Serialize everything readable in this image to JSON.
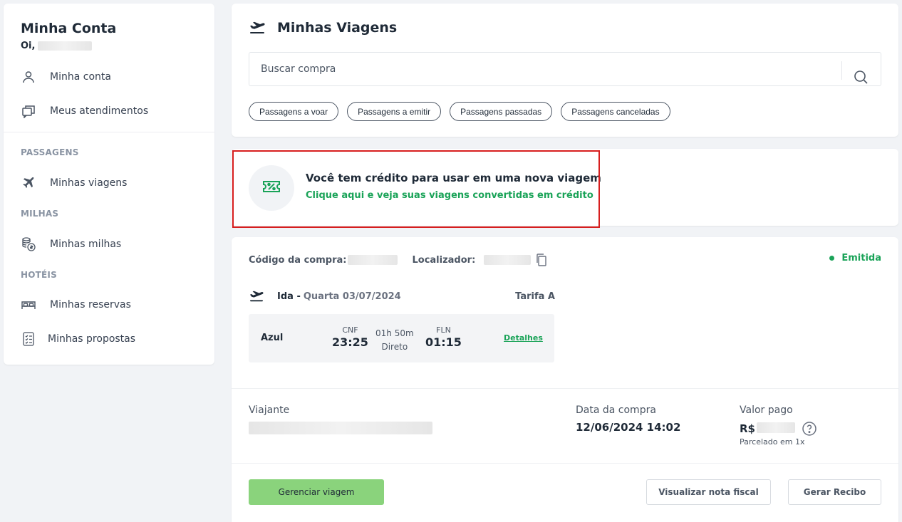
{
  "sidebar": {
    "title": "Minha Conta",
    "greeting": "Oi,",
    "items": [
      {
        "label": "Minha conta",
        "icon": "user-icon"
      },
      {
        "label": "Meus atendimentos",
        "icon": "chat-icon"
      }
    ],
    "sections": [
      {
        "title": "PASSAGENS",
        "items": [
          {
            "label": "Minhas viagens",
            "icon": "airplane-icon"
          }
        ]
      },
      {
        "title": "MILHAS",
        "items": [
          {
            "label": "Minhas milhas",
            "icon": "coins-icon"
          }
        ]
      },
      {
        "title": "HOTÉIS",
        "items": [
          {
            "label": "Minhas reservas",
            "icon": "bed-icon"
          },
          {
            "label": "Minhas propostas",
            "icon": "checklist-icon"
          }
        ]
      }
    ]
  },
  "header": {
    "title": "Minhas Viagens",
    "search_placeholder": "Buscar compra",
    "filters": [
      "Passagens a voar",
      "Passagens a emitir",
      "Passagens passadas",
      "Passagens canceladas"
    ]
  },
  "credit": {
    "title": "Você tem crédito para usar em uma nova viagem",
    "link": "Clique aqui e veja suas viagens convertidas em crédito",
    "highlight_color": "#d71e1e"
  },
  "trip": {
    "purchase_code_label": "Código da compra:",
    "locator_label": "Localizador:",
    "status": "Emitida",
    "leg": {
      "direction": "Ida -",
      "date": "Quarta 03/07/2024",
      "fare": "Tarifa A",
      "airline": "Azul",
      "origin_code": "CNF",
      "departure_time": "23:25",
      "duration": "01h 50m",
      "stops": "Direto",
      "destination_code": "FLN",
      "arrival_time": "01:15",
      "details_link": "Detalhes"
    },
    "traveler_label": "Viajante",
    "purchase_date_label": "Data da compra",
    "purchase_date": "12/06/2024 14:02",
    "paid_label": "Valor pago",
    "currency": "R$",
    "installments": "Parcelado em 1x",
    "buttons": {
      "manage": "Gerenciar viagem",
      "invoice": "Visualizar nota fiscal",
      "receipt": "Gerar Recibo"
    }
  },
  "colors": {
    "accent_green": "#1aa358",
    "primary_button": "#8ad37c",
    "background": "#f1f3f6"
  }
}
